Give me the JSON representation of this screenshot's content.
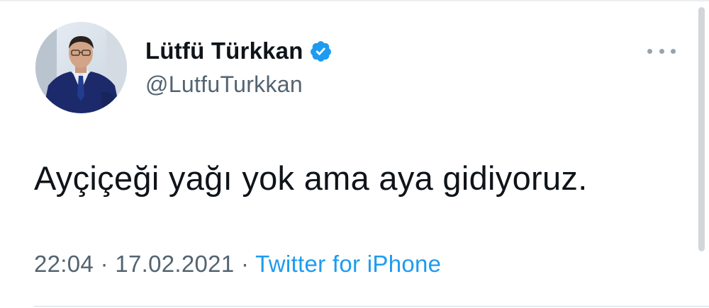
{
  "tweet": {
    "author": {
      "display_name": "Lütfü Türkkan",
      "handle": "@LutfuTurkkan",
      "verified": true,
      "avatar_icon": "profile-photo"
    },
    "more_icon": "more-horizontal-icon",
    "text": "Ayçiçeği yağı yok ama aya gidiyoruz.",
    "meta": {
      "time": "22:04",
      "separator": "·",
      "date": "17.02.2021",
      "source": "Twitter for iPhone"
    }
  },
  "colors": {
    "text_primary": "#0f1419",
    "text_secondary": "#536471",
    "accent": "#1d9bf0",
    "verified": "#1d9bf0"
  }
}
